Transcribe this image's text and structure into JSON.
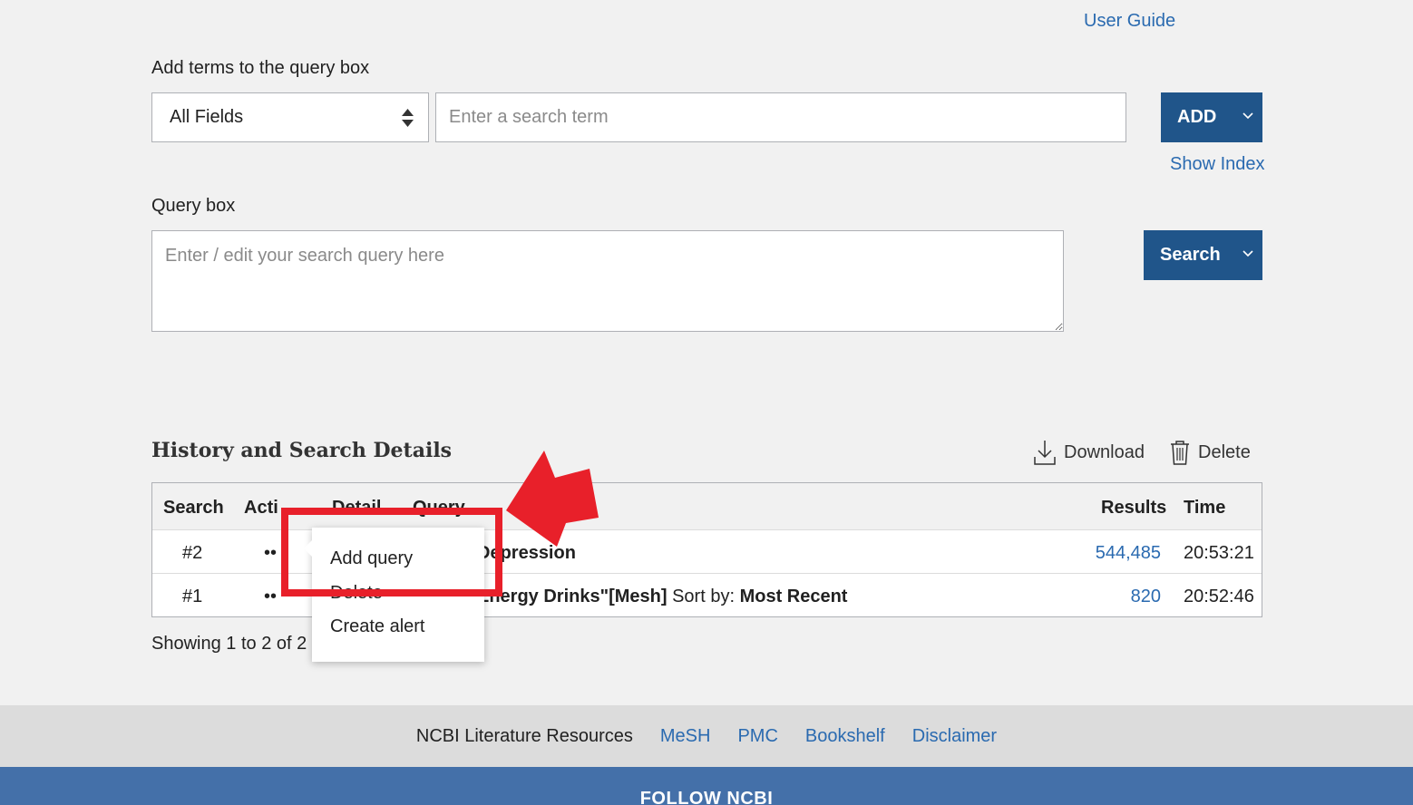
{
  "header": {
    "user_guide": "User Guide"
  },
  "builder": {
    "label": "Add terms to the query box",
    "field_select": "All Fields",
    "term_placeholder": "Enter a search term",
    "add_button": "ADD",
    "show_index": "Show Index"
  },
  "query": {
    "label": "Query box",
    "placeholder": "Enter / edit your search query here",
    "search_button": "Search"
  },
  "history": {
    "title": "History and Search Details",
    "download": "Download",
    "delete": "Delete",
    "columns": [
      "Search",
      "Acti",
      "Detail",
      "Query",
      "Results",
      "Time"
    ],
    "rows": [
      {
        "search": "#2",
        "actions": "••",
        "query_bold": "Depression",
        "query_rest": "",
        "query_bold2": "",
        "results": "544,485",
        "time": "20:53:21"
      },
      {
        "search": "#1",
        "actions": "••",
        "query_bold": "Energy Drinks\"[Mesh]",
        "query_rest": " Sort by: ",
        "query_bold2": "Most Recent",
        "results": "820",
        "time": "20:52:46"
      }
    ],
    "showing": "Showing 1 to 2 of 2"
  },
  "action_menu": {
    "items": [
      "Add query",
      "Delete",
      "Create alert"
    ]
  },
  "footer": {
    "resources_label": "NCBI Literature Resources",
    "links": [
      "MeSH",
      "PMC",
      "Bookshelf",
      "Disclaimer"
    ],
    "follow": "FOLLOW NCBI"
  },
  "colors": {
    "primary": "#20558a",
    "link": "#2a6ab0",
    "highlight": "#e8202a",
    "follow_bar": "#4470a9"
  }
}
